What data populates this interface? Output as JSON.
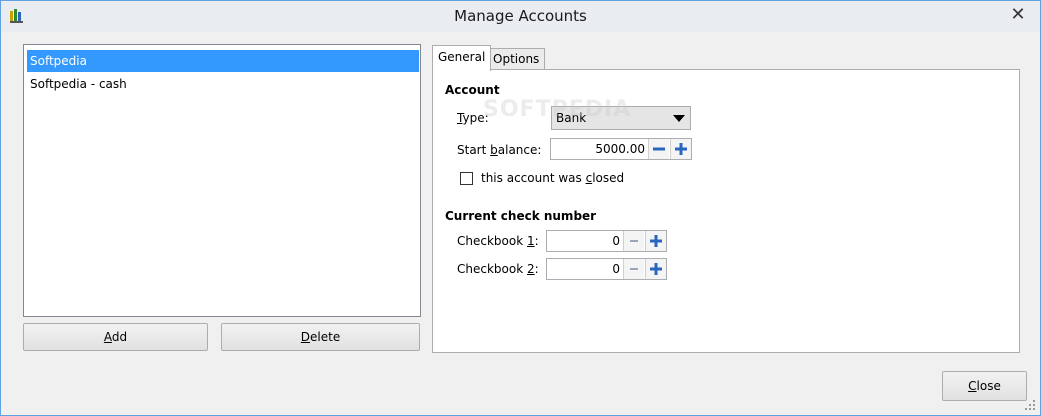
{
  "window": {
    "title": "Manage Accounts",
    "close_glyph": "✕"
  },
  "accounts": {
    "items": [
      {
        "label": "Softpedia",
        "selected": true
      },
      {
        "label": "Softpedia - cash",
        "selected": false
      }
    ],
    "add_label_u": "A",
    "add_label_rest": "dd",
    "delete_label_u": "D",
    "delete_label_rest": "elete"
  },
  "tabs": [
    {
      "label": "General",
      "active": true
    },
    {
      "label": "Options",
      "active": false
    }
  ],
  "general": {
    "account_heading": "Account",
    "type_label_u": "T",
    "type_label_rest": "ype:",
    "type_value": "Bank",
    "start_balance_label_pre": "Start ",
    "start_balance_label_u": "b",
    "start_balance_label_rest": "alance:",
    "start_balance_value": "5000.00",
    "closed_label_pre": "this account was ",
    "closed_label_u": "c",
    "closed_label_rest": "losed",
    "closed_checked": false,
    "check_heading": "Current check number",
    "checkbook1_label_pre": "Checkbook ",
    "checkbook1_label_u": "1",
    "checkbook1_label_rest": ":",
    "checkbook1_value": "0",
    "checkbook2_label_pre": "Checkbook ",
    "checkbook2_label_u": "2",
    "checkbook2_label_rest": ":",
    "checkbook2_value": "0"
  },
  "footer": {
    "close_label_u": "C",
    "close_label_rest": "lose"
  },
  "colors": {
    "selection": "#3399ff",
    "window_border": "#5fa2dd",
    "spin_plus": "#2a66c0"
  },
  "watermark": "SOFTPEDIA"
}
